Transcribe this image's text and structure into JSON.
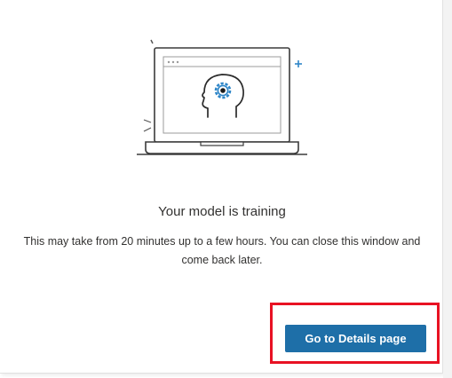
{
  "dialog": {
    "title": "Your model is training",
    "description": "This may take from 20 minutes up to a few hours. You can close this window and come back later.",
    "primary_button_label": "Go to Details page"
  },
  "colors": {
    "accent": "#1e6fa8",
    "highlight": "#e81123",
    "gear": "#2f86c8"
  },
  "icons": {
    "illustration": "laptop-with-head-gear-icon"
  }
}
